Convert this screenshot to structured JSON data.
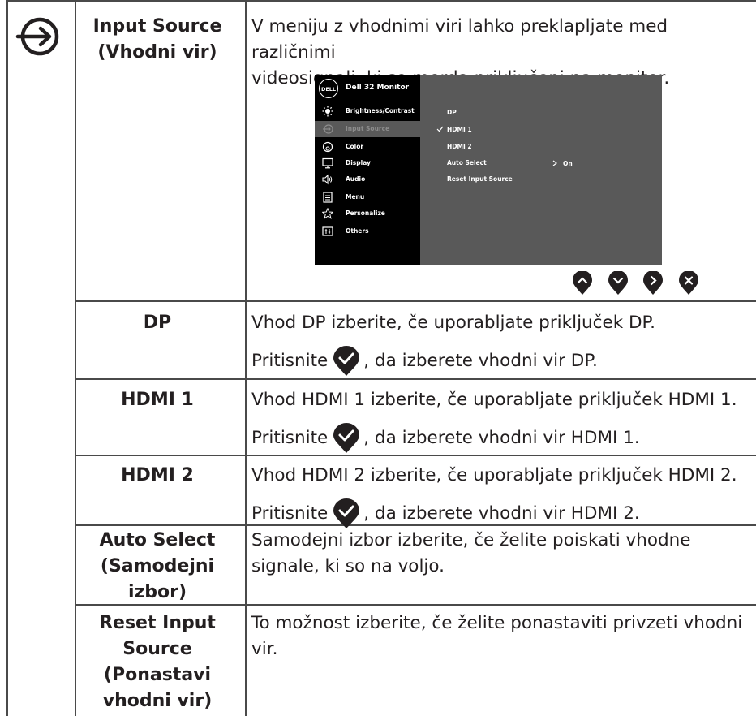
{
  "rows": [
    {
      "label_lines": [
        "Input Source",
        "(Vhodni vir)"
      ],
      "desc_lines": [
        "V meniju z vhodnimi viri lahko preklapljate med različnimi",
        "videosignali, ki so morda priključeni na monitor."
      ]
    },
    {
      "label_lines": [
        "DP"
      ],
      "desc_line1": "Vhod DP izberite, če uporabljate priključek DP.",
      "desc_pre": "Pritisnite",
      "desc_post": ", da izberete vhodni vir DP."
    },
    {
      "label_lines": [
        "HDMI 1"
      ],
      "desc_line1": "Vhod HDMI 1 izberite, če uporabljate priključek HDMI 1.",
      "desc_pre": "Pritisnite",
      "desc_post": ", da izberete vhodni vir HDMI 1."
    },
    {
      "label_lines": [
        "HDMI 2"
      ],
      "desc_line1": "Vhod HDMI 2 izberite, če uporabljate priključek HDMI 2.",
      "desc_pre": "Pritisnite",
      "desc_post": ", da izberete vhodni vir HDMI 2."
    },
    {
      "label_lines": [
        "Auto Select",
        "(Samodejni",
        "izbor)"
      ],
      "desc_lines": [
        "Samodejni izbor izberite, če želite poiskati vhodne",
        "signale, ki so na voljo."
      ]
    },
    {
      "label_lines": [
        "Reset Input",
        "Source",
        "(Ponastavi",
        "vhodni vir)"
      ],
      "desc_lines": [
        "To možnost izberite, če želite ponastaviti privzeti vhodni",
        "vir."
      ]
    }
  ],
  "osd": {
    "logo_text": "DELL",
    "title": "Dell 32 Monitor",
    "menu": [
      {
        "icon": "brightness-icon",
        "label": "Brightness/Contrast",
        "active": false
      },
      {
        "icon": "input-source-icon",
        "label": "Input Source",
        "active": true
      },
      {
        "icon": "color-icon",
        "label": "Color",
        "active": false
      },
      {
        "icon": "display-icon",
        "label": "Display",
        "active": false
      },
      {
        "icon": "audio-icon",
        "label": "Audio",
        "active": false
      },
      {
        "icon": "menu-icon",
        "label": "Menu",
        "active": false
      },
      {
        "icon": "personalize-star-icon",
        "label": "Personalize",
        "active": false
      },
      {
        "icon": "others-icon",
        "label": "Others",
        "active": false
      }
    ],
    "submenu": [
      "DP",
      "HDMI 1",
      "HDMI 2",
      "Auto Select",
      "Reset Input Source"
    ],
    "selected_submenu": "HDMI 1",
    "auto_select_value": "On",
    "colors": {
      "left_panel": "#000000",
      "right_panel": "#595959",
      "active_text": "#8c8c8c"
    }
  },
  "nav_buttons": [
    "up-button-icon",
    "down-button-icon",
    "right-button-icon",
    "close-button-icon"
  ]
}
